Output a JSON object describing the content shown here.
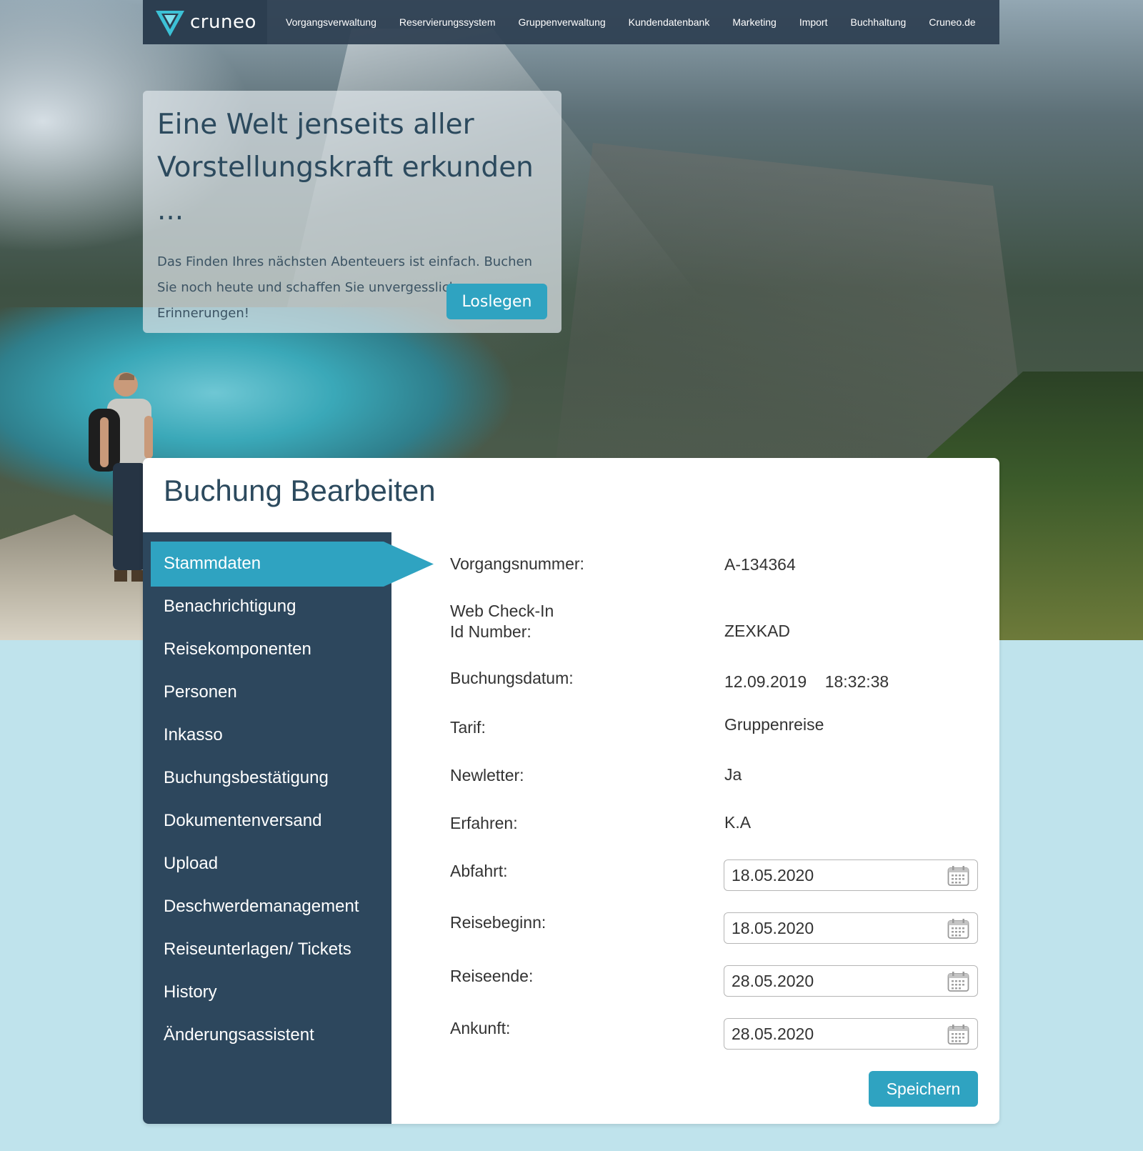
{
  "brand": {
    "name": "cruneo",
    "logo_icon": "triangle-logo-icon"
  },
  "nav": {
    "items": [
      {
        "label": "Vorgangsverwaltung"
      },
      {
        "label": "Reservierungssystem"
      },
      {
        "label": "Gruppenverwaltung"
      },
      {
        "label": "Kundendatenbank"
      },
      {
        "label": "Marketing"
      },
      {
        "label": "Import"
      },
      {
        "label": "Buchhaltung"
      },
      {
        "label": "Cruneo.de"
      }
    ]
  },
  "hero": {
    "title_line1": "Eine Welt jenseits aller",
    "title_line2": "Vorstellungskraft erkunden ...",
    "text": "Das Finden Ihres nächsten Abenteuers ist einfach. Buchen Sie noch heute und schaffen Sie unvergessliche Erinnerungen!",
    "cta_label": "Loslegen"
  },
  "page": {
    "title": "Buchung Bearbeiten"
  },
  "sidebar": {
    "active_label": "Stammdaten",
    "items": [
      {
        "label": "Benachrichtigung"
      },
      {
        "label": "Reisekomponenten"
      },
      {
        "label": "Personen"
      },
      {
        "label": "Inkasso"
      },
      {
        "label": "Buchungsbestätigung"
      },
      {
        "label": "Dokumentenversand"
      },
      {
        "label": "Upload"
      },
      {
        "label": "Deschwerdemanagement"
      },
      {
        "label": "Reiseunterlagen/ Tickets"
      },
      {
        "label": "History"
      },
      {
        "label": "Änderungsassistent"
      }
    ]
  },
  "form": {
    "vorgangsnummer": {
      "label": "Vorgangsnummer:",
      "value": "A-134364"
    },
    "webcheckin": {
      "label_line1": "Web Check-In",
      "label_line2": "Id Number:",
      "value": "ZEXKAD"
    },
    "buchungsdatum": {
      "label": "Buchungsdatum:",
      "date": "12.09.2019",
      "time": "18:32:38"
    },
    "tarif": {
      "label": "Tarif:",
      "value": "Gruppenreise"
    },
    "newsletter": {
      "label": "Newletter:",
      "value": "Ja"
    },
    "erfahren": {
      "label": "Erfahren:",
      "value": "K.A"
    },
    "abfahrt": {
      "label": "Abfahrt:",
      "value": "18.05.2020"
    },
    "reisebeginn": {
      "label": "Reisebeginn:",
      "value": "18.05.2020"
    },
    "reiseende": {
      "label": "Reiseende:",
      "value": "28.05.2020"
    },
    "ankunft": {
      "label": "Ankunft:",
      "value": "28.05.2020"
    },
    "save_label": "Speichern"
  },
  "colors": {
    "accent": "#2fa3c1",
    "nav_bg": "#2c3e50",
    "sidebar_bg": "#2d475d",
    "page_bg": "#bfe3ec"
  }
}
